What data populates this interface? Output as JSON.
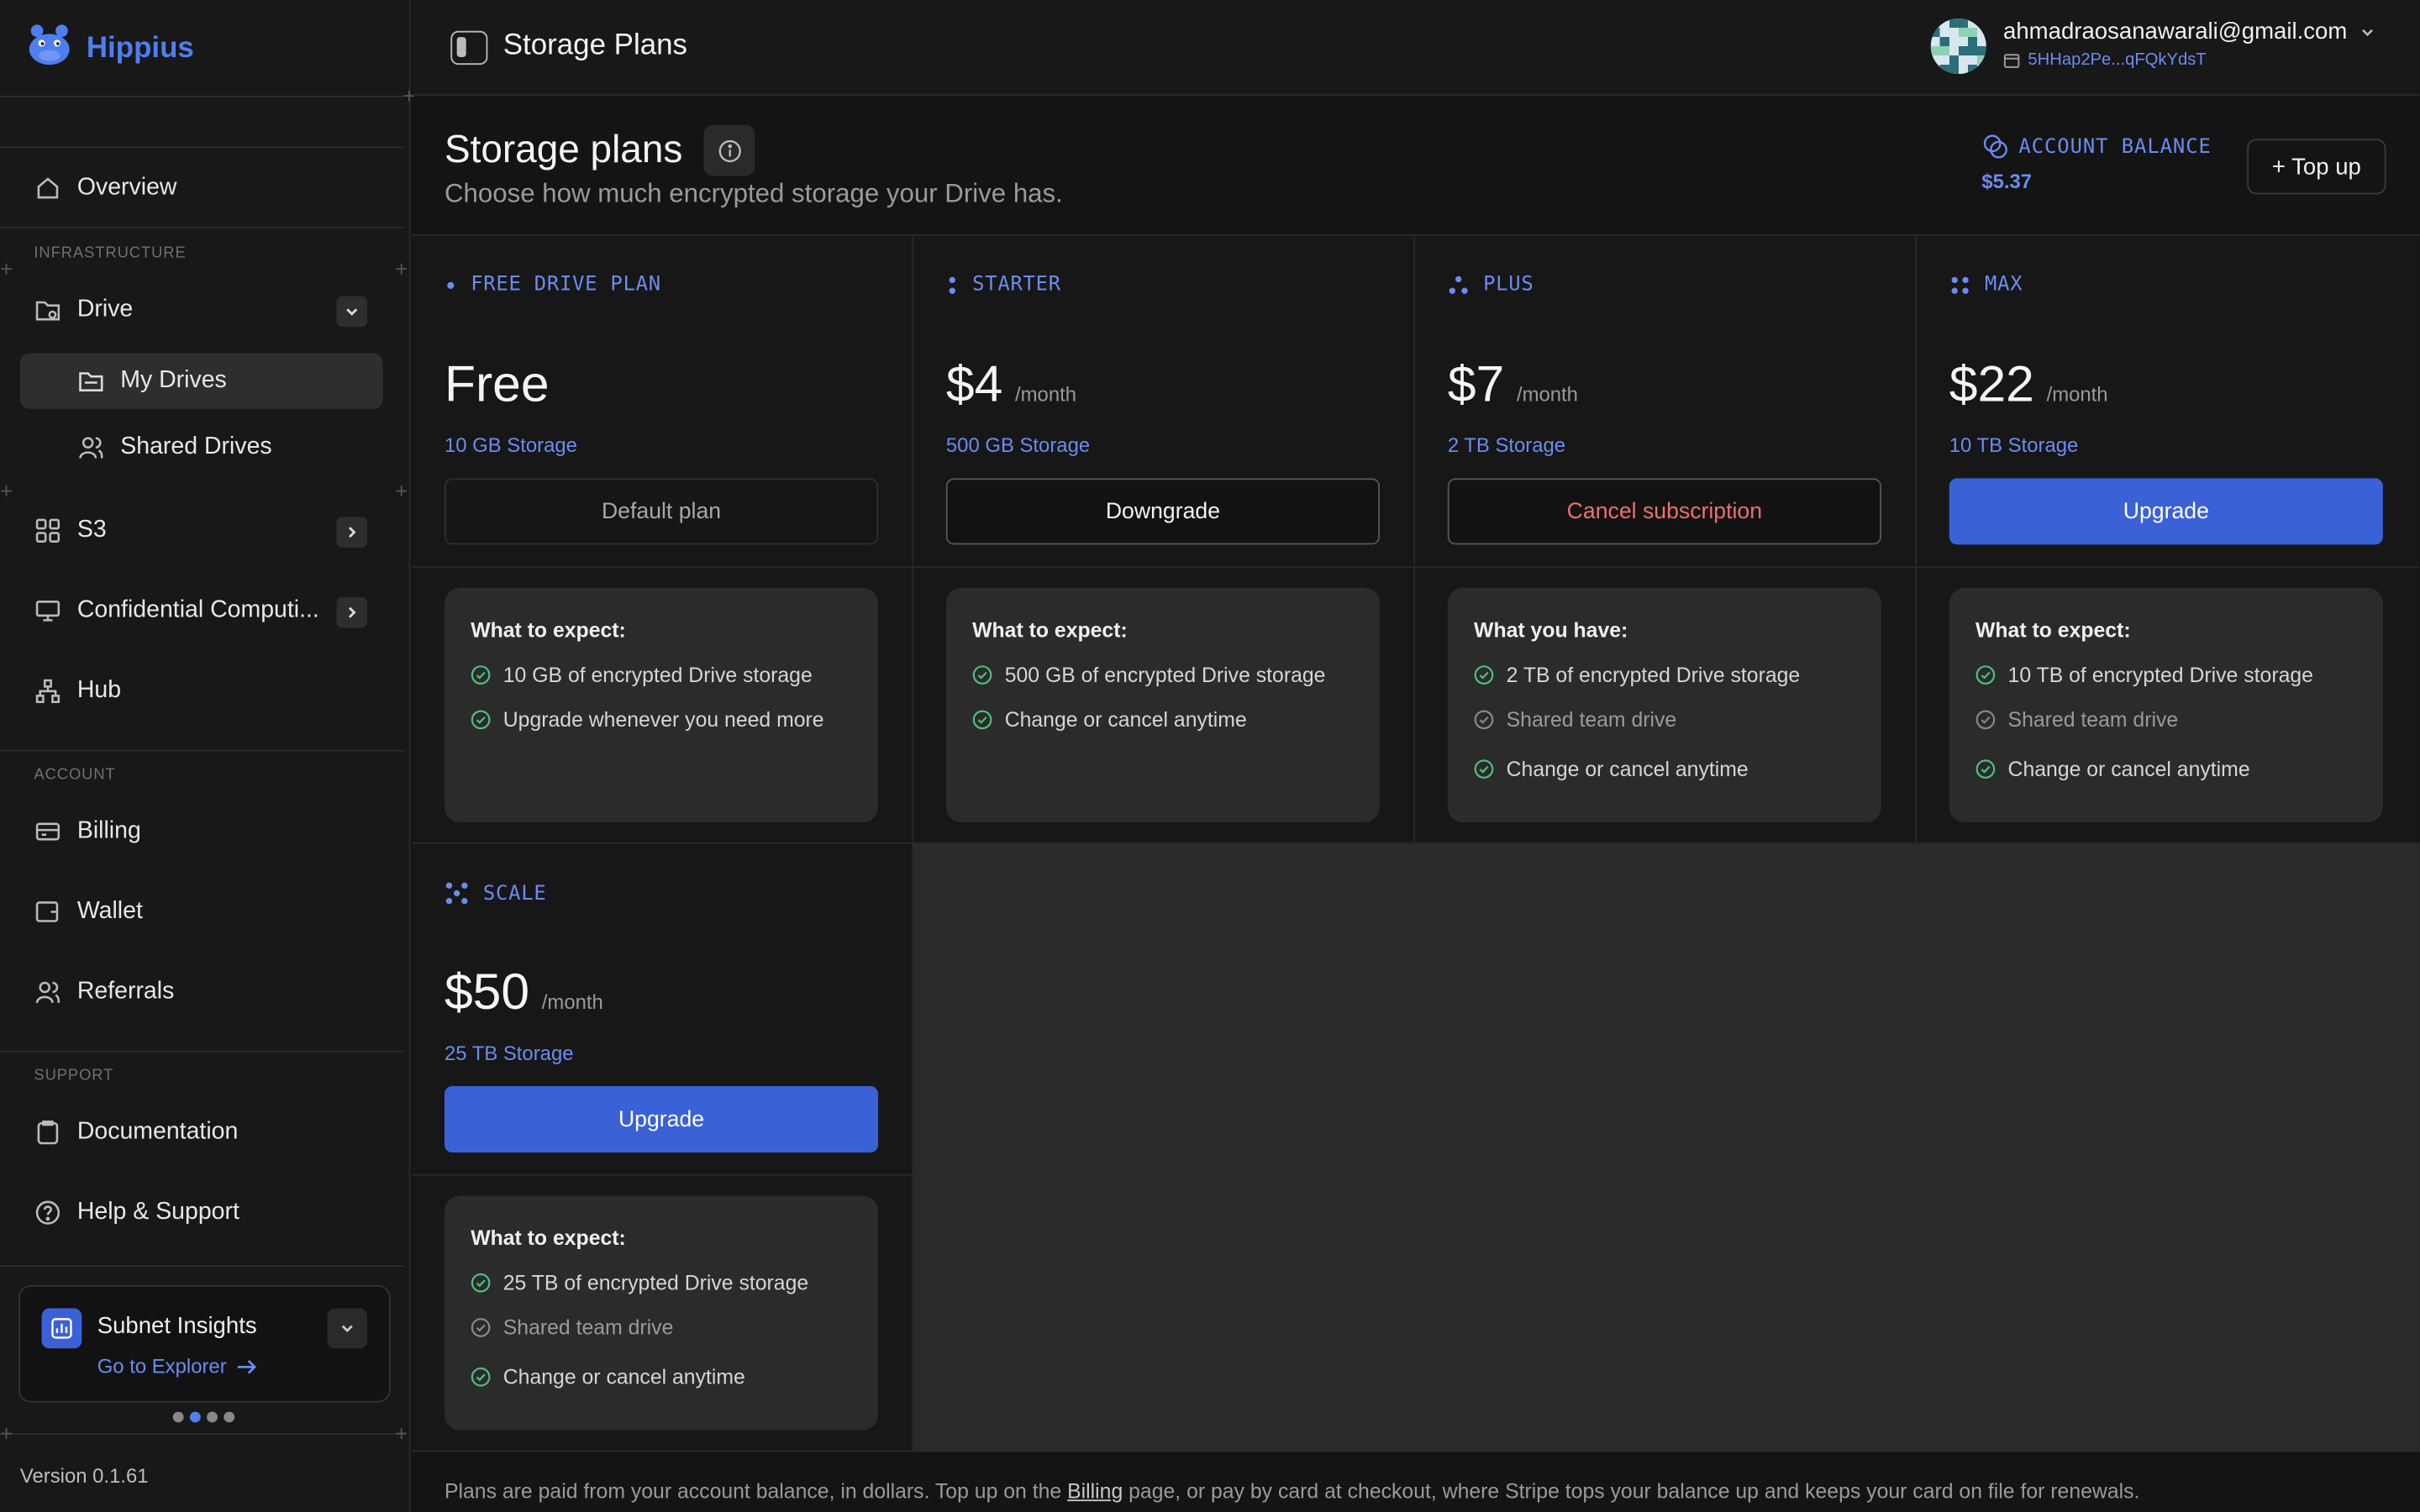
{
  "brand": {
    "name": "Hippius"
  },
  "sidebar": {
    "overview": "Overview",
    "section_infra": "INFRASTRUCTURE",
    "drive": "Drive",
    "my_drives": "My Drives",
    "shared_drives": "Shared Drives",
    "s3": "S3",
    "confidential": "Confidential Computi...",
    "hub": "Hub",
    "section_account": "ACCOUNT",
    "billing": "Billing",
    "wallet": "Wallet",
    "referrals": "Referrals",
    "section_support": "SUPPORT",
    "documentation": "Documentation",
    "help": "Help & Support",
    "insights": {
      "title": "Subnet Insights",
      "link": "Go to Explorer"
    },
    "version": "Version 0.1.61"
  },
  "header": {
    "title": "Storage Plans",
    "email": "ahmadraosanawarali@gmail.com",
    "wallet": "5HHap2Pe...qFQkYdsT"
  },
  "main": {
    "title": "Storage plans",
    "subtitle": "Choose how much encrypted storage your Drive has.",
    "balance_label": "ACCOUNT BALANCE",
    "balance_value": "$5.37",
    "topup_label": "+ Top up",
    "footer_pre": "Plans are paid from your account balance, in dollars. Top up on the ",
    "footer_link": "Billing",
    "footer_post": " page, or pay by card at checkout, where Stripe tops your balance up and keeps your card on file for renewals."
  },
  "plans": [
    {
      "tag": "FREE DRIVE PLAN",
      "price": "Free",
      "per": "",
      "storage": "10 GB Storage",
      "action": "Default plan",
      "heading": "What to expect:",
      "features": [
        "10 GB of encrypted Drive storage",
        "Upgrade whenever you need more"
      ]
    },
    {
      "tag": "STARTER",
      "price": "$4",
      "per": "/month",
      "storage": "500 GB Storage",
      "action": "Downgrade",
      "heading": "What to expect:",
      "features": [
        "500 GB of encrypted Drive storage",
        "Change or cancel anytime"
      ]
    },
    {
      "tag": "PLUS",
      "price": "$7",
      "per": "/month",
      "storage": "2 TB Storage",
      "action": "Cancel subscription",
      "heading": "What you have:",
      "features": [
        "2 TB of encrypted Drive storage",
        "Shared team drive",
        "Change or cancel anytime"
      ]
    },
    {
      "tag": "MAX",
      "price": "$22",
      "per": "/month",
      "storage": "10 TB Storage",
      "action": "Upgrade",
      "heading": "What to expect:",
      "features": [
        "10 TB of encrypted Drive storage",
        "Shared team drive",
        "Change or cancel anytime"
      ]
    },
    {
      "tag": "SCALE",
      "price": "$50",
      "per": "/month",
      "storage": "25 TB Storage",
      "action": "Upgrade",
      "heading": "What to expect:",
      "features": [
        "25 TB of encrypted Drive storage",
        "Shared team drive",
        "Change or cancel anytime"
      ]
    }
  ],
  "colors": {
    "accent": "#4f7ef0",
    "button_primary": "#3a62d6",
    "danger": "#f06e6e",
    "check": "#4fbf7a"
  }
}
